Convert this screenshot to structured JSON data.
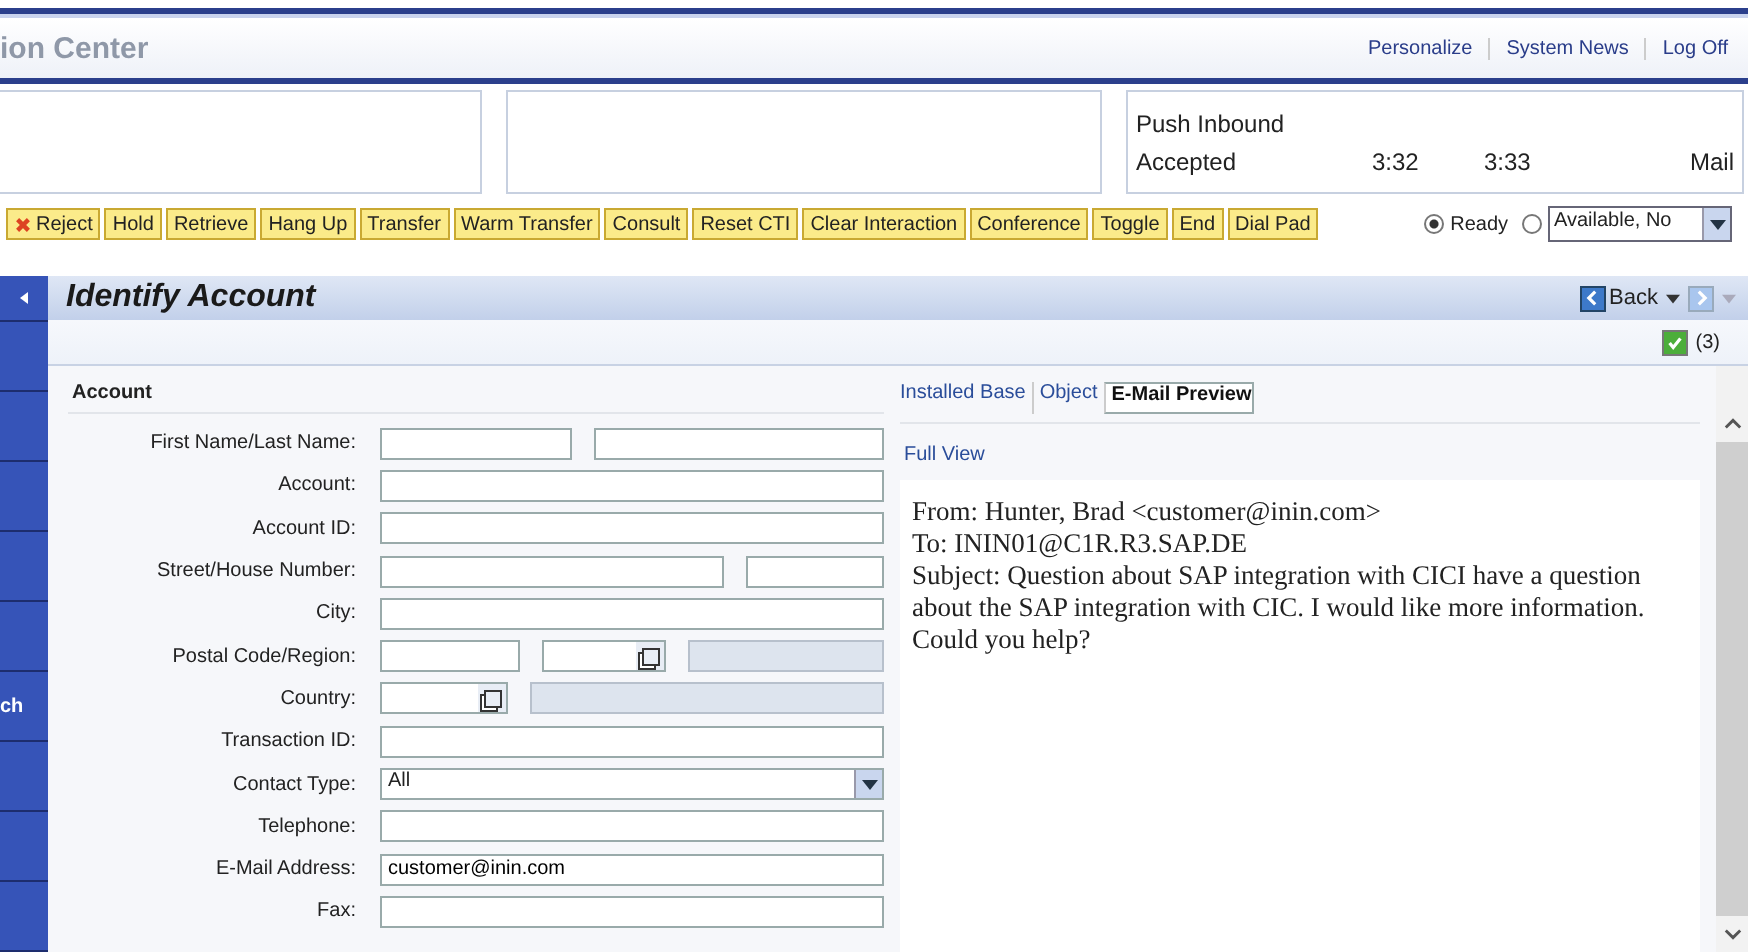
{
  "header": {
    "title": "ion Center",
    "links": [
      "Personalize",
      "System News",
      "Log Off"
    ]
  },
  "panels": {
    "status": "Push Inbound",
    "state": "Accepted",
    "time_1": "3:32",
    "time_2": "3:33",
    "channel": "Mail"
  },
  "toolbar": [
    {
      "label": "Reject",
      "kind": "reject"
    },
    {
      "label": "Hold",
      "kind": "plain"
    },
    {
      "label": "Retrieve",
      "kind": "plain"
    },
    {
      "label": "Hang Up",
      "kind": "plain"
    },
    {
      "label": "Transfer",
      "kind": "plain"
    },
    {
      "label": "Warm Transfer",
      "kind": "plain"
    },
    {
      "label": "Consult",
      "kind": "plain"
    },
    {
      "label": "Reset CTI",
      "kind": "plain"
    },
    {
      "label": "Clear Interaction",
      "kind": "plain"
    },
    {
      "label": "Conference",
      "kind": "plain"
    },
    {
      "label": "Toggle",
      "kind": "plain"
    },
    {
      "label": "End",
      "kind": "plain"
    },
    {
      "label": "Dial Pad",
      "kind": "plain"
    }
  ],
  "availability": {
    "options": [
      {
        "label": "Ready",
        "selected": true
      },
      {
        "selected": false
      }
    ],
    "dropdown": "Available, No"
  },
  "sidebar": {
    "label": "ch"
  },
  "page": {
    "title": "Identify Account",
    "back": "Back",
    "count": "(3)",
    "checked": true
  },
  "account": {
    "heading": "Account",
    "fields": [
      {
        "label": "First Name/Last Name:",
        "kind": "double"
      },
      {
        "label": "Account:",
        "kind": "text"
      },
      {
        "label": "Account ID:",
        "kind": "text"
      },
      {
        "label": "Street/House Number:",
        "kind": "street"
      },
      {
        "label": "City:",
        "kind": "text"
      },
      {
        "label": "Postal Code/Region:",
        "kind": "postal"
      },
      {
        "label": "Country:",
        "kind": "country"
      },
      {
        "label": "Transaction ID:",
        "kind": "text"
      },
      {
        "label": "Contact Type:",
        "kind": "select",
        "value": "All"
      },
      {
        "label": "Telephone:",
        "kind": "text"
      },
      {
        "label": "E-Mail Address:",
        "kind": "text",
        "value": "customer@inin.com"
      },
      {
        "label": "Fax:",
        "kind": "text"
      }
    ]
  },
  "preview": {
    "tabs": [
      {
        "label": "Installed Base",
        "selected": false
      },
      {
        "label": "Object",
        "selected": false
      },
      {
        "label": "E-Mail Preview",
        "selected": true
      }
    ],
    "full_view": "Full View",
    "email": [
      "From: Hunter, Brad <customer@inin.com>",
      "To: ININ01@C1R.R3.SAP.DE",
      "Subject: Question about SAP integration with CICI have a question about the SAP integration with CIC. I would like more information. Could you help?"
    ]
  }
}
